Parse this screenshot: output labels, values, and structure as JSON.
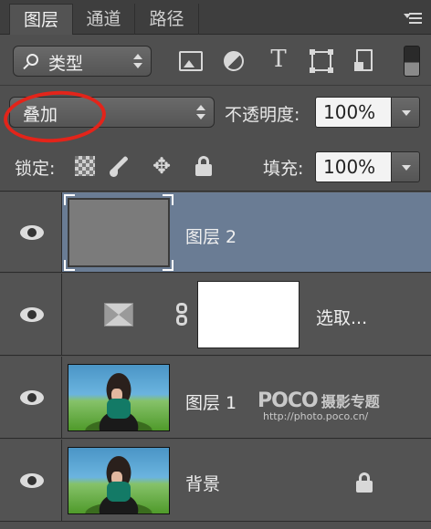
{
  "tabs": [
    {
      "label": "图层",
      "active": true
    },
    {
      "label": "通道",
      "active": false
    },
    {
      "label": "路径",
      "active": false
    }
  ],
  "filter": {
    "kind_label": "类型",
    "icons": [
      "pixel-layer-filter-icon",
      "adjustment-layer-filter-icon",
      "type-layer-filter-icon",
      "shape-layer-filter-icon",
      "smart-object-filter-icon"
    ],
    "type_glyph": "T"
  },
  "blend": {
    "mode": "叠加",
    "opacity_label": "不透明度:",
    "opacity_value": "100%"
  },
  "lock": {
    "label": "锁定:",
    "fill_label": "填充:",
    "fill_value": "100%",
    "move_glyph": "✥"
  },
  "layers": [
    {
      "name": "图层 2",
      "selected": true,
      "visible": true
    },
    {
      "name": "选取...",
      "selected": false,
      "visible": true
    },
    {
      "name": "图层 1",
      "selected": false,
      "visible": true
    },
    {
      "name": "背景",
      "selected": false,
      "visible": true,
      "locked": true
    }
  ],
  "watermark": {
    "logo": "POCO",
    "logo_cn": "摄影专题",
    "url": "http://photo.poco.cn/"
  },
  "colors": {
    "panel": "#535353",
    "selected_row": "#6a7c94",
    "annotation": "#e3241a"
  }
}
